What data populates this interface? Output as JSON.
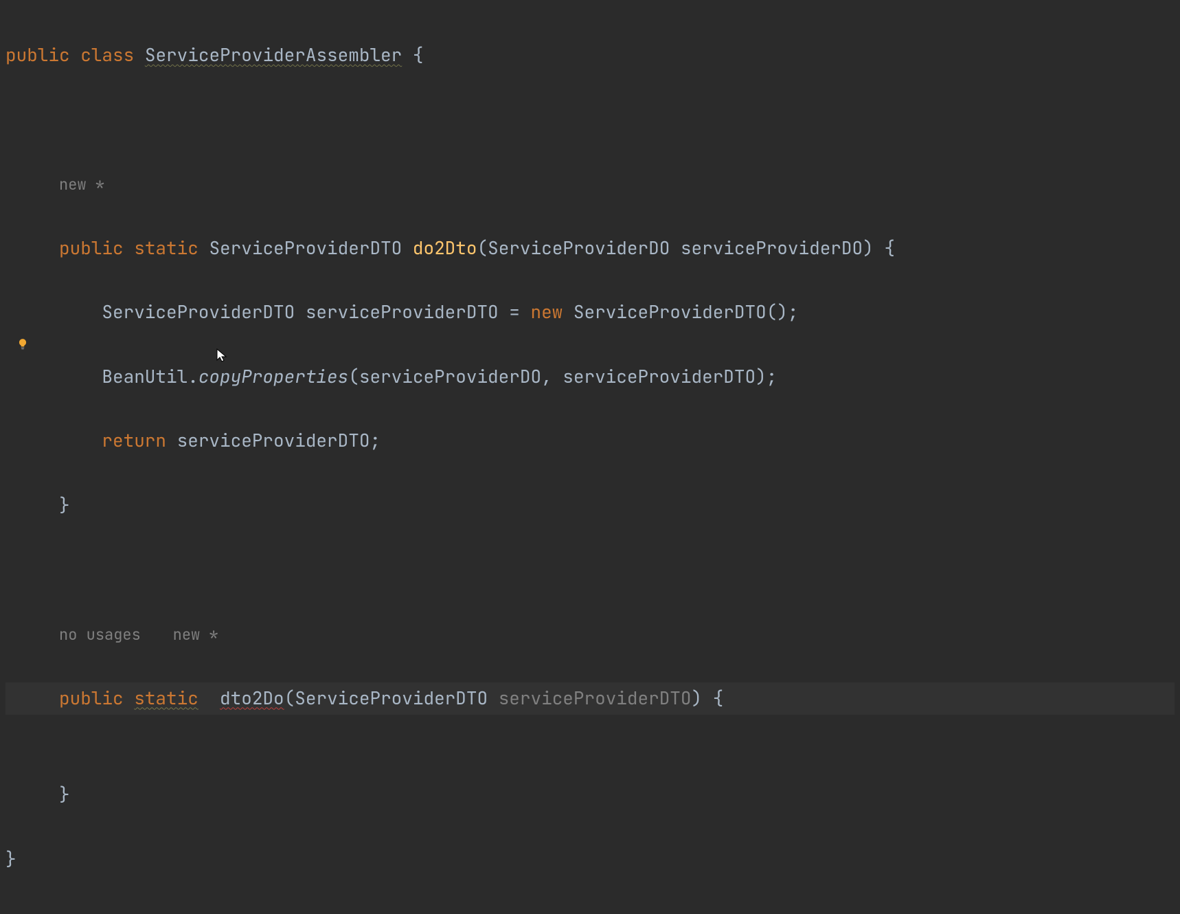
{
  "code": {
    "line1": {
      "keyword_public": "public",
      "keyword_class": "class",
      "class_name": "ServiceProviderAssembler",
      "brace_open": "{"
    },
    "hint1": {
      "text": "new *"
    },
    "method1": {
      "keyword_public": "public",
      "keyword_static": "static",
      "return_type": "ServiceProviderDTO",
      "method_name": "do2Dto",
      "paren_open": "(",
      "param_type": "ServiceProviderDO",
      "param_name": "serviceProviderDO",
      "paren_close": ")",
      "brace_open": "{"
    },
    "body1_line1": {
      "type": "ServiceProviderDTO",
      "var_name": "serviceProviderDTO",
      "equals": "=",
      "keyword_new": "new",
      "ctor": "ServiceProviderDTO",
      "parens": "()",
      "semi": ";"
    },
    "body1_line2": {
      "class_ref": "BeanUtil",
      "dot": ".",
      "method": "copyProperties",
      "paren_open": "(",
      "arg1": "serviceProviderDO",
      "comma": ",",
      "arg2": "serviceProviderDTO",
      "paren_close": ")",
      "semi": ";"
    },
    "body1_line3": {
      "keyword_return": "return",
      "var": "serviceProviderDTO",
      "semi": ";"
    },
    "body1_close": {
      "brace": "}"
    },
    "hint2": {
      "no_usages": "no usages",
      "new_marker": "new *"
    },
    "method2": {
      "keyword_public": "public",
      "keyword_static": "static",
      "method_name": "dto2Do",
      "paren_open": "(",
      "param_type": "ServiceProviderDTO",
      "param_name": "serviceProviderDTO",
      "paren_close": ")",
      "brace_open": "{"
    },
    "body2_close": {
      "brace": "}"
    },
    "class_close": {
      "brace": "}"
    }
  }
}
